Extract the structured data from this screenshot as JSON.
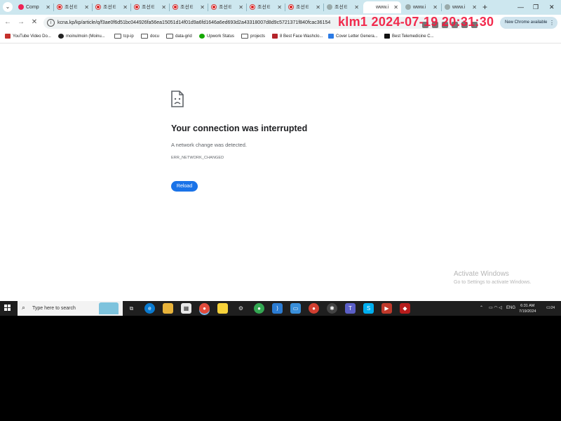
{
  "watermark": "klm1 2024-07-19 20:31:30",
  "tabs": [
    {
      "label": "Comp",
      "favicon": "comp"
    },
    {
      "label": "조선ㅌ",
      "favicon": "kr"
    },
    {
      "label": "조선ㅌ",
      "favicon": "kr"
    },
    {
      "label": "조선ㅌ",
      "favicon": "kr"
    },
    {
      "label": "조선ㅌ",
      "favicon": "kr"
    },
    {
      "label": "조선ㅌ",
      "favicon": "kr"
    },
    {
      "label": "조선ㅌ",
      "favicon": "kr"
    },
    {
      "label": "조선ㅌ",
      "favicon": "kr"
    },
    {
      "label": "조선ㅌ",
      "favicon": "globe"
    },
    {
      "label": "www.i",
      "favicon": "none"
    },
    {
      "label": "www.i",
      "favicon": "globe"
    },
    {
      "label": "www.i",
      "favicon": "globe"
    }
  ],
  "toolbar": {
    "url": "kcna.kp/kp/article/q/f3ae0f6d51bc044926fa56ea15051d14f01d9a6fd1646a6ed693d2a43318007d8d9c5721371f840fcac36154",
    "update_label": "New Chrome available"
  },
  "bookmarks": [
    {
      "label": "YouTube Video Do...",
      "icon": "youtube-icon",
      "color": "#c4302b"
    },
    {
      "label": "moinulmoin (Moinu...",
      "icon": "github-icon",
      "color": "#222222"
    },
    {
      "label": "tcp-ip",
      "icon": "folder-icon",
      "color": "folder"
    },
    {
      "label": "docu",
      "icon": "folder-icon",
      "color": "folder"
    },
    {
      "label": "data-grid",
      "icon": "folder-icon",
      "color": "folder"
    },
    {
      "label": "Upwork Status",
      "icon": "upwork-icon",
      "color": "#14a800"
    },
    {
      "label": "projects",
      "icon": "folder-icon",
      "color": "folder"
    },
    {
      "label": "8 Best Face Washclo...",
      "icon": "bookmark-favicon",
      "color": "#b4232a"
    },
    {
      "label": "Cover Letter Genera...",
      "icon": "bookmark-favicon",
      "color": "#2c7be5"
    },
    {
      "label": "Best Telemedicine C...",
      "icon": "bookmark-favicon",
      "color": "#111111"
    }
  ],
  "error": {
    "title": "Your connection was interrupted",
    "description": "A network change was detected.",
    "code": "ERR_NETWORK_CHANGED",
    "reload_label": "Reload"
  },
  "activation": {
    "line1": "Activate Windows",
    "line2": "Go to Settings to activate Windows."
  },
  "taskbar": {
    "search_placeholder": "Type here to search",
    "language": "ENG",
    "time": "6:31 AM",
    "date": "7/19/2024",
    "notification_count": "24"
  }
}
